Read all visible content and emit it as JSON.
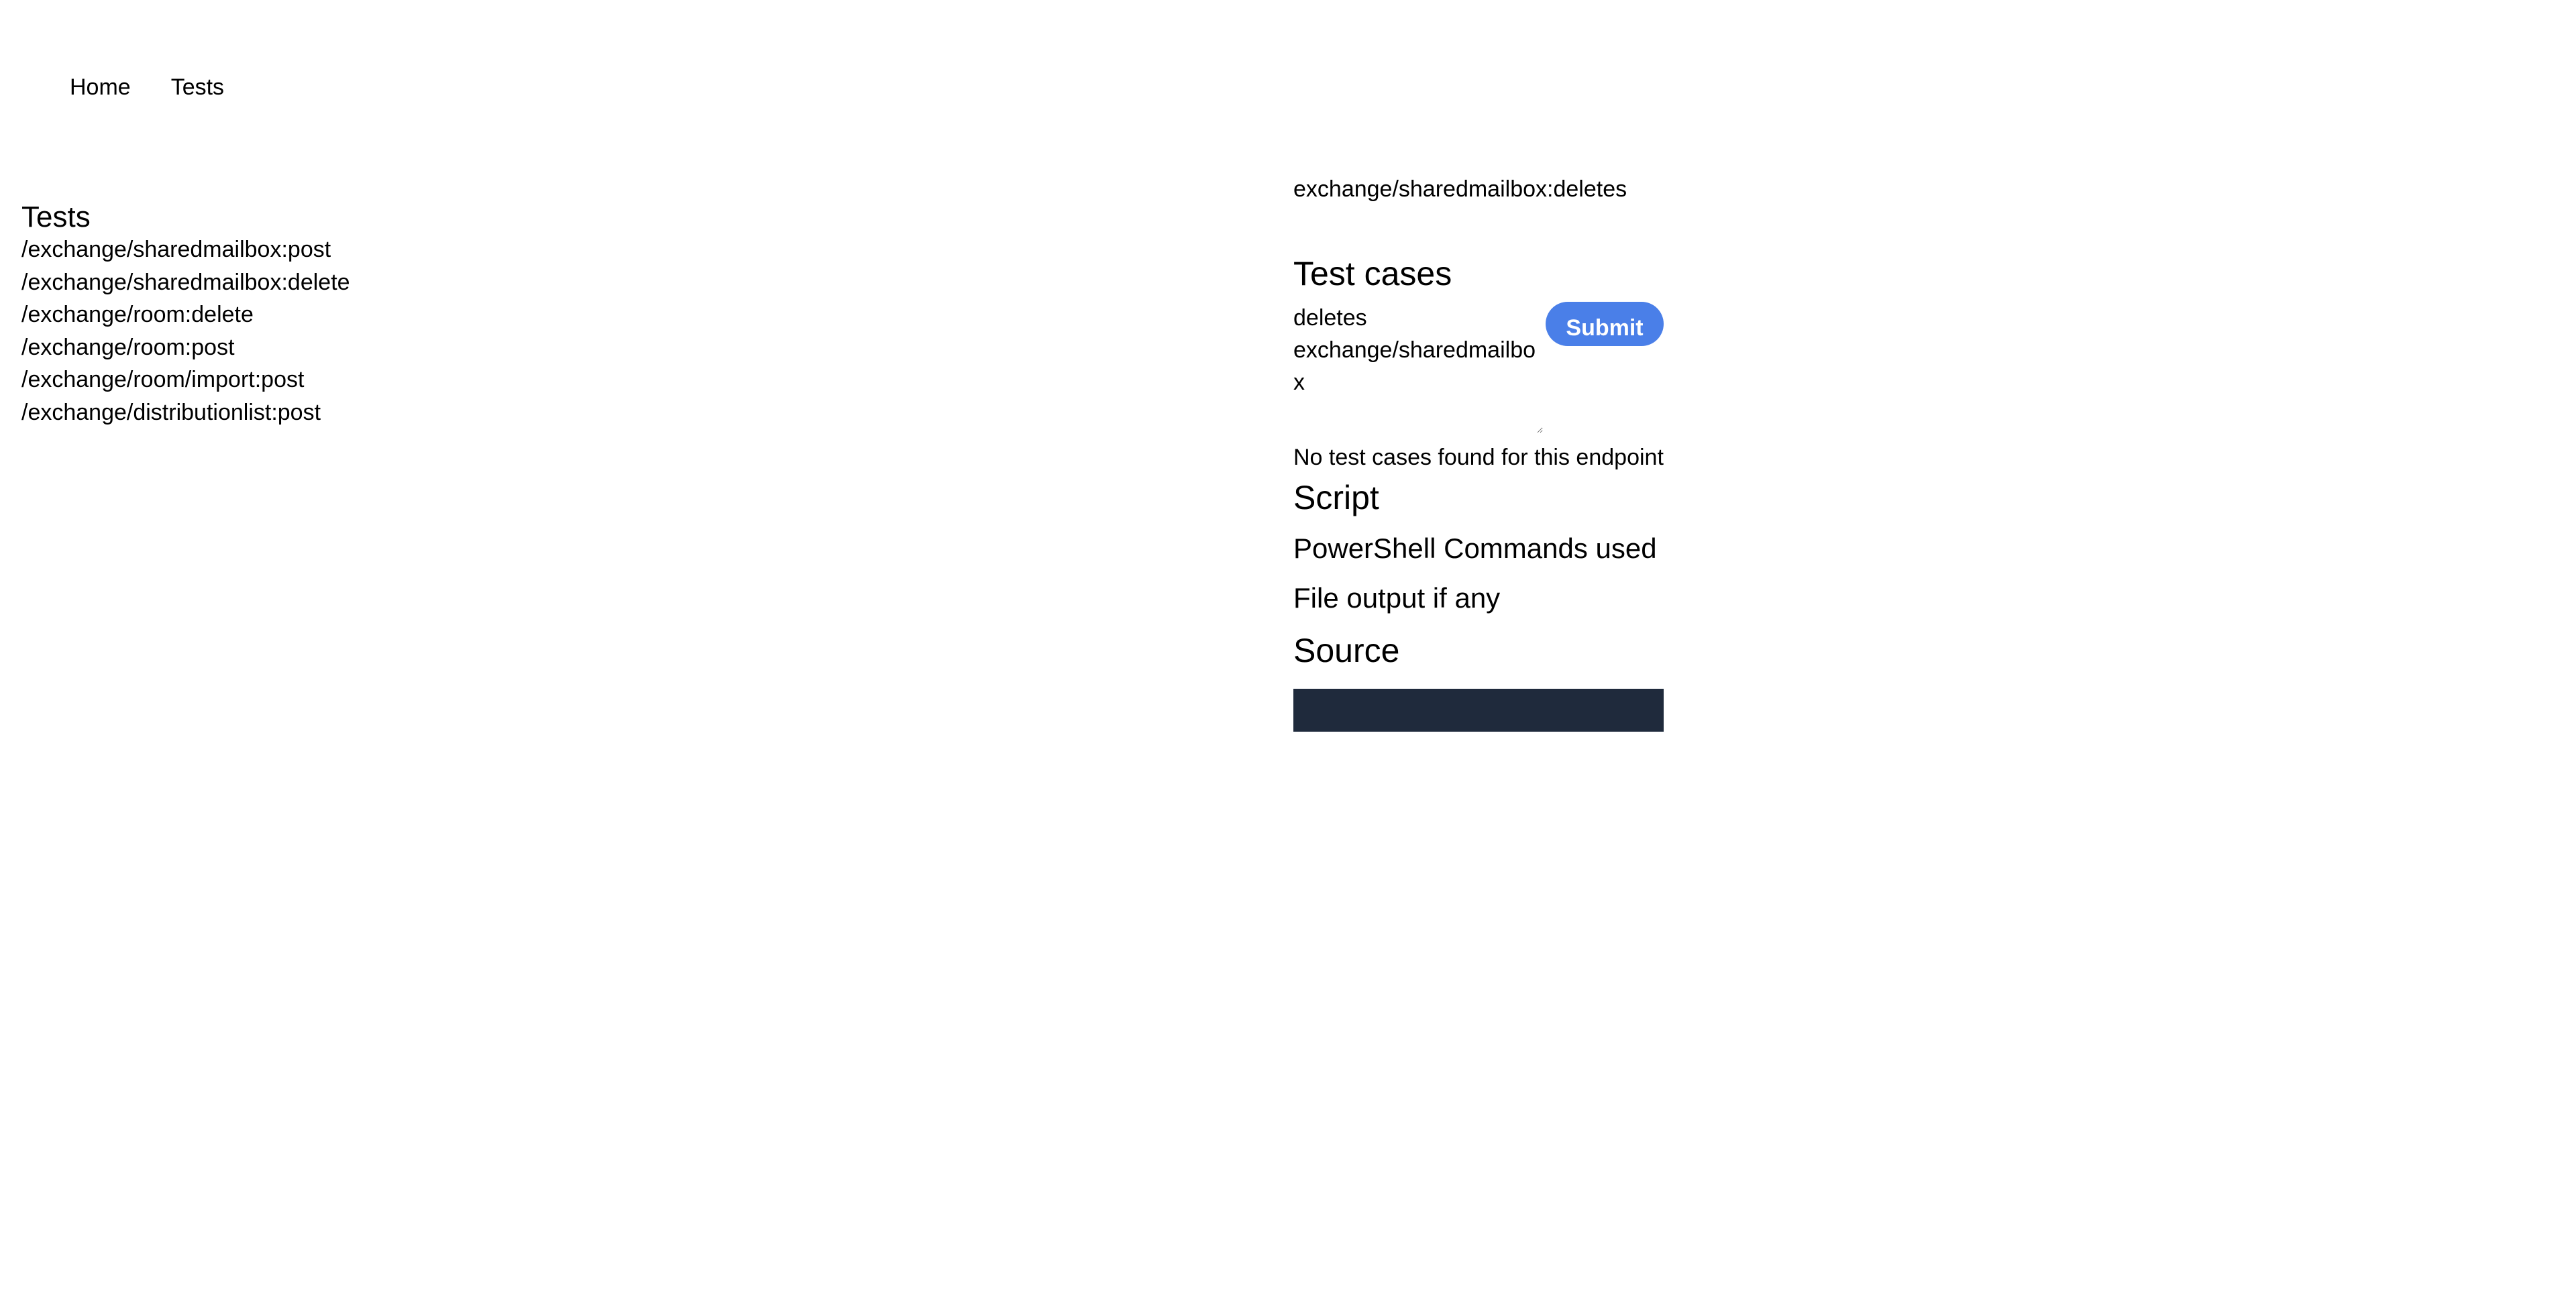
{
  "nav": {
    "items": [
      {
        "label": "Home"
      },
      {
        "label": "Tests"
      }
    ]
  },
  "tests": {
    "heading": "Tests",
    "items": [
      "/exchange/sharedmailbox:post",
      "/exchange/sharedmailbox:delete",
      "/exchange/room:delete",
      "/exchange/room:post",
      "/exchange/room/import:post",
      "/exchange/distributionlist:post"
    ]
  },
  "detail": {
    "endpoint": "exchange/sharedmailbox:deletes",
    "test_cases_heading": "Test cases",
    "textarea_value": "deletes exchange/sharedmailbox",
    "submit_label": "Submit",
    "no_cases_text": "No test cases found for this endpoint",
    "script_heading": "Script",
    "powershell_heading": "PowerShell Commands used",
    "file_output_heading": "File output if any",
    "source_heading": "Source"
  },
  "colors": {
    "accent": "#4a7fe8",
    "source_bg": "#1f2a3c"
  }
}
